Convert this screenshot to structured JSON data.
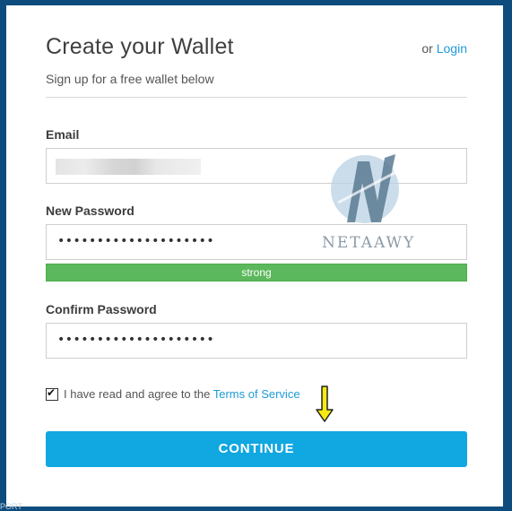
{
  "header": {
    "title": "Create your Wallet",
    "login_prefix": "or",
    "login_link": "Login",
    "subtitle": "Sign up for a free wallet below"
  },
  "form": {
    "email_label": "Email",
    "email_value": "",
    "new_password_label": "New Password",
    "new_password_value": "••••••••••••••••••••",
    "strength_label": "strong",
    "strength_level": 1.0,
    "confirm_password_label": "Confirm Password",
    "confirm_password_value": "••••••••••••••••••••",
    "terms_checked": true,
    "terms_text": "I have read and agree to the",
    "terms_link": "Terms of Service",
    "continue_label": "CONTINUE"
  },
  "watermark": {
    "text": "NETAAWY",
    "icon": "netaawy-logo-icon"
  },
  "annotation": {
    "icon": "arrow-down-icon",
    "color": "#f5ea14"
  },
  "footer": {
    "corner_text": "PORT"
  },
  "colors": {
    "background": "#0e4c7e",
    "accent": "#11a7e0",
    "link": "#1e9bd7",
    "strength": "#5cb85c"
  }
}
